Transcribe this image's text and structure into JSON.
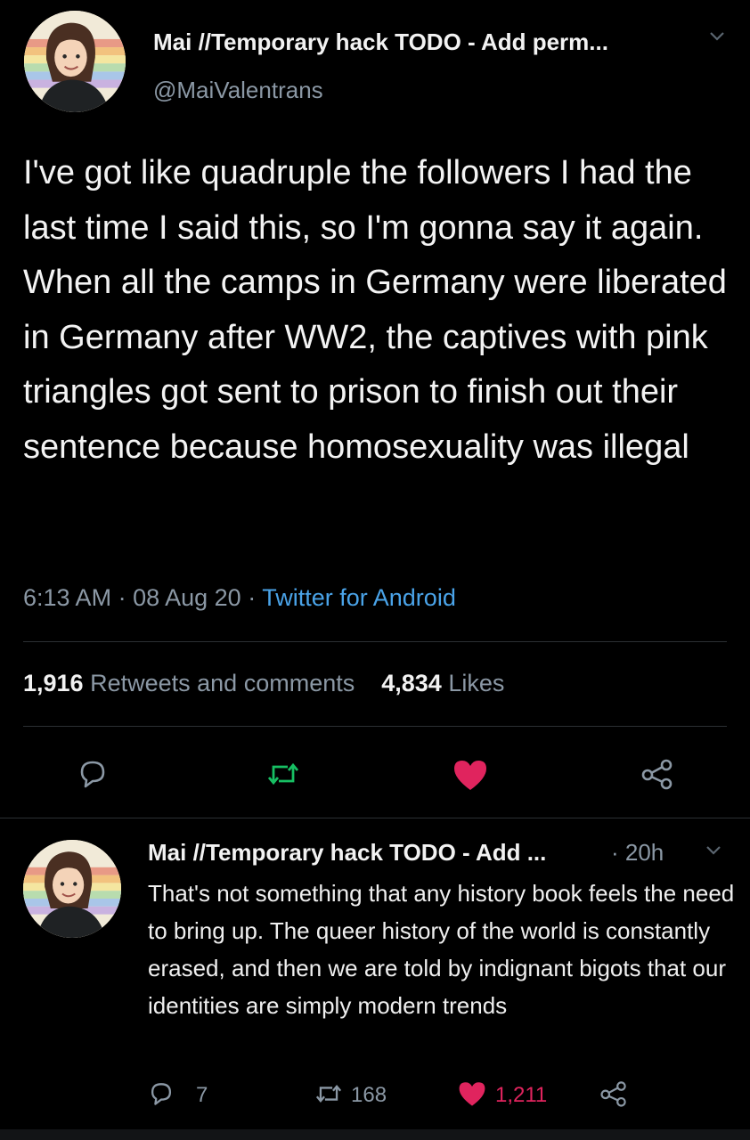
{
  "tweet": {
    "display_name": "Mai //Temporary hack TODO - Add perm...",
    "handle": "@MaiValentrans",
    "text": "I've got like quadruple the followers I had the last time I said this, so I'm gonna say it again. When all the camps in Germany were liberated in Germany after WW2, the captives with pink triangles got sent to prison to finish out their sentence because homosexuality was illegal",
    "time": "6:13 AM",
    "date": "08 Aug 20",
    "source": "Twitter for Android",
    "retweets_count": "1,916",
    "retweets_label": "Retweets and comments",
    "likes_count": "4,834",
    "likes_label": "Likes"
  },
  "reply": {
    "display_name": "Mai //Temporary hack TODO - Add ...",
    "time": "20h",
    "text": "That's not something that any history book feels the need to bring up. The queer history of the world is constantly erased, and then we are told by indignant bigots that our identities are simply modern trends",
    "reply_count": "7",
    "retweet_count": "168",
    "like_count": "1,211"
  },
  "icons": {
    "reply": "reply-icon",
    "retweet": "retweet-icon",
    "like": "heart-icon",
    "share": "share-icon",
    "more": "chevron-down-icon"
  },
  "colors": {
    "background": "#000000",
    "muted": "#8b98a5",
    "link": "#4aa3e8",
    "retweet_green": "#17bf63",
    "like_pink": "#e0245e"
  }
}
